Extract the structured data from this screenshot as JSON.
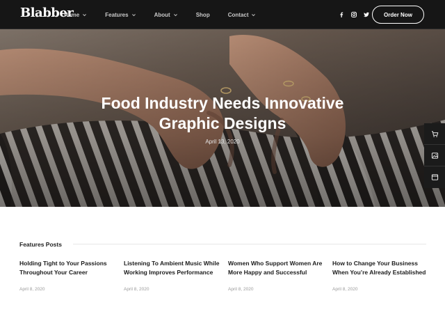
{
  "header": {
    "logo": "Blabber",
    "nav": [
      {
        "label": "Home",
        "has_dropdown": true
      },
      {
        "label": "Features",
        "has_dropdown": true
      },
      {
        "label": "About",
        "has_dropdown": true
      },
      {
        "label": "Shop",
        "has_dropdown": false
      },
      {
        "label": "Contact",
        "has_dropdown": true
      }
    ],
    "socials": [
      "facebook-icon",
      "instagram-icon",
      "twitter-icon"
    ],
    "cta_label": "Order Now"
  },
  "hero": {
    "title": "Food Industry Needs Innovative Graphic Designs",
    "date": "April 13, 2020"
  },
  "side_actions": [
    "cart-icon",
    "image-icon",
    "browser-icon"
  ],
  "features": {
    "heading": "Features Posts",
    "posts": [
      {
        "title": "Holding Tight to Your Passions Throughout Your Career",
        "date": "April 8, 2020"
      },
      {
        "title": "Listening To Ambient Music While Working Improves Performance",
        "date": "April 8, 2020"
      },
      {
        "title": "Women Who Support Women Are More Happy and Successful",
        "date": "April 8, 2020"
      },
      {
        "title": "How to Change Your Business When You’re Already Established",
        "date": "April 8, 2020"
      }
    ]
  },
  "colors": {
    "header_bg": "#161616",
    "sidebar_bg": "#1b1b1b",
    "text_dark": "#1c1c1c",
    "date_gray": "#9a9a9a"
  }
}
